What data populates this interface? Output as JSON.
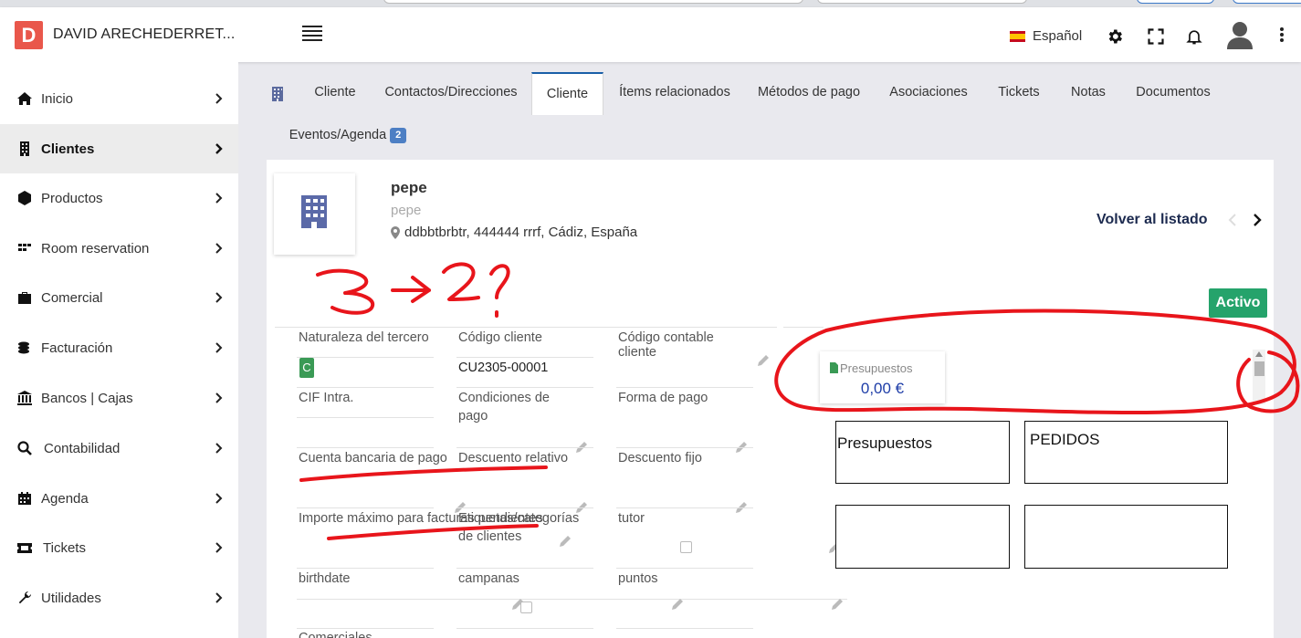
{
  "header": {
    "logo_letter": "D",
    "company_name": "DAVID ARECHEDERRET...",
    "language": "Español",
    "icons": [
      "menu-icon",
      "settings-icon",
      "fullscreen-icon",
      "bell-icon",
      "user-avatar-icon",
      "more-vertical-icon"
    ]
  },
  "sidebar": {
    "items": [
      {
        "label": "Inicio",
        "icon": "home-icon"
      },
      {
        "label": "Clientes",
        "icon": "building-icon"
      },
      {
        "label": "Productos",
        "icon": "cube-icon"
      },
      {
        "label": "Room reservation",
        "icon": "grid-icon"
      },
      {
        "label": "Comercial",
        "icon": "briefcase-icon"
      },
      {
        "label": "Facturación",
        "icon": "coins-icon"
      },
      {
        "label": "Bancos | Cajas",
        "icon": "bank-icon"
      },
      {
        "label": "Contabilidad",
        "icon": "search-dollar-icon"
      },
      {
        "label": "Agenda",
        "icon": "calendar-icon"
      },
      {
        "label": "Tickets",
        "icon": "ticket-icon"
      },
      {
        "label": "Utilidades",
        "icon": "wrench-icon"
      }
    ],
    "active_index": 1
  },
  "tabs": {
    "items": [
      {
        "label": "Cliente"
      },
      {
        "label": "Contactos/Direcciones"
      },
      {
        "label": "Cliente"
      },
      {
        "label": "Ítems relacionados"
      },
      {
        "label": "Métodos de pago"
      },
      {
        "label": "Asociaciones"
      },
      {
        "label": "Tickets"
      },
      {
        "label": "Notas"
      },
      {
        "label": "Documentos"
      }
    ],
    "events_label": "Eventos/Agenda",
    "events_count": "2",
    "active_index": 2
  },
  "thirdparty": {
    "name": "pepe",
    "alias": "pepe",
    "address": "ddbbtbrbtr, 444444 rrrf, Cádiz, España",
    "back_link": "Volver al listado",
    "status": "Activo"
  },
  "fields": {
    "naturaleza_label": "Naturaleza del tercero",
    "naturaleza_value": "C",
    "codigo_cliente_label": "Código cliente",
    "codigo_cliente_value": "CU2305-00001",
    "codigo_contable_label": "Código contable cliente",
    "cif_label": "CIF Intra.",
    "condiciones_label_1": "Condiciones de",
    "condiciones_label_2": "pago",
    "forma_pago_label": "Forma de pago",
    "cuenta_bancaria_label": "Cuenta bancaria de pago",
    "descuento_relativo_label": "Descuento relativo",
    "descuento_fijo_label": "Descuento fijo",
    "importe_maximo_label": "Importe máximo para facturas pendientes",
    "etiquetas_label_1": "Etiquetas/categorías",
    "etiquetas_label_2": "de clientes",
    "tutor_label": "tutor",
    "birthdate_label": "birthdate",
    "campanas_label": "campanas",
    "puntos_label": "puntos",
    "comerciales_label": "Comerciales"
  },
  "widget": {
    "label": "Presupuestos",
    "value": "0,00 €"
  },
  "boxes": {
    "presupuestos": "Presupuestos",
    "pedidos": "PEDIDOS",
    "empty_1": "",
    "empty_2": ""
  },
  "annotations": {
    "handwritten_note": "3 → 2 ?",
    "stroke_color": "#e8151b"
  },
  "colors": {
    "logo": "#e9574b",
    "active_status": "#25a36b",
    "tab_active_border": "#1a5fa8",
    "badge": "#4d7fc4",
    "widget_value": "#1f3ea8"
  }
}
